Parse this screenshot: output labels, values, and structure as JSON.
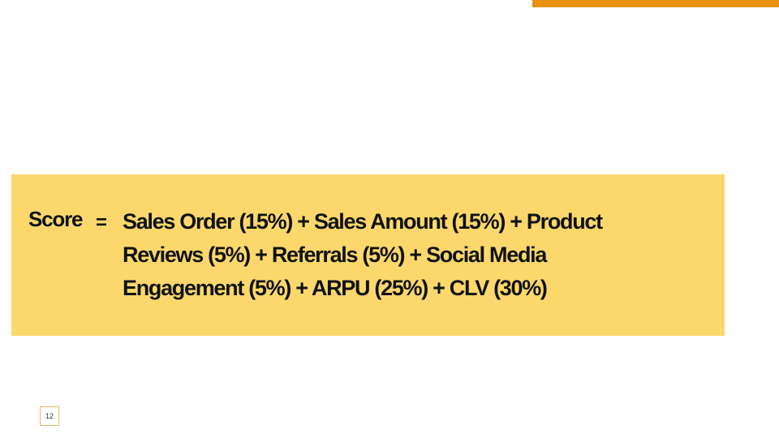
{
  "colors": {
    "accent_bar": "#E8920F",
    "formula_box_bg": "#FCD86C",
    "text": "#111111"
  },
  "formula": {
    "label": "Score",
    "operator": "=",
    "lines": [
      "Sales Order (15%)  + Sales Amount (15%)  + Product",
      "Reviews (5%) + Referrals (5%) + Social Media",
      "Engagement (5%) + ARPU (25%) + CLV (30%)"
    ]
  },
  "page_number": "12"
}
